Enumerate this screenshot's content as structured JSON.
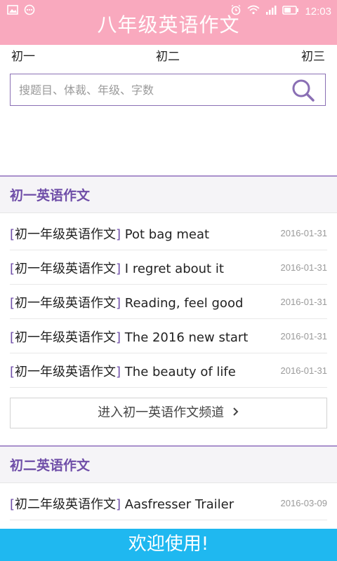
{
  "statusbar": {
    "time": "12:03",
    "left_icons": [
      "image-icon",
      "chat-dots-icon"
    ],
    "right_icons": [
      "alarm-icon",
      "wifi-icon",
      "signal-icon",
      "battery-icon"
    ]
  },
  "header": {
    "title": "八年级英语作文"
  },
  "grade_tabs": [
    {
      "label": "初一"
    },
    {
      "label": "初二"
    },
    {
      "label": "初三"
    }
  ],
  "search": {
    "placeholder": "搜题目、体裁、年级、字数"
  },
  "sections": [
    {
      "title": "初一英语作文",
      "articles": [
        {
          "tag": "初一年级英语作文",
          "title": " Pot bag meat",
          "date": "2016-01-31"
        },
        {
          "tag": "初一年级英语作文",
          "title": " I regret about it",
          "date": "2016-01-31"
        },
        {
          "tag": "初一年级英语作文",
          "title": " Reading, feel good",
          "date": "2016-01-31"
        },
        {
          "tag": "初一年级英语作文",
          "title": " The 2016 new start",
          "date": "2016-01-31"
        },
        {
          "tag": "初一年级英语作文",
          "title": " The beauty of life",
          "date": "2016-01-31"
        }
      ],
      "more_label": "进入初一英语作文频道"
    },
    {
      "title": "初二英语作文",
      "articles": [
        {
          "tag": "初二年级英语作文",
          "title": " Aasfresser Trailer",
          "date": "2016-03-09"
        }
      ]
    }
  ],
  "bottom_bar": {
    "text": "欢迎使用!"
  },
  "colors": {
    "header_bg": "#f9a9be",
    "accent": "#6f4ea8",
    "bottom_bar_bg": "#1fb8f0"
  }
}
